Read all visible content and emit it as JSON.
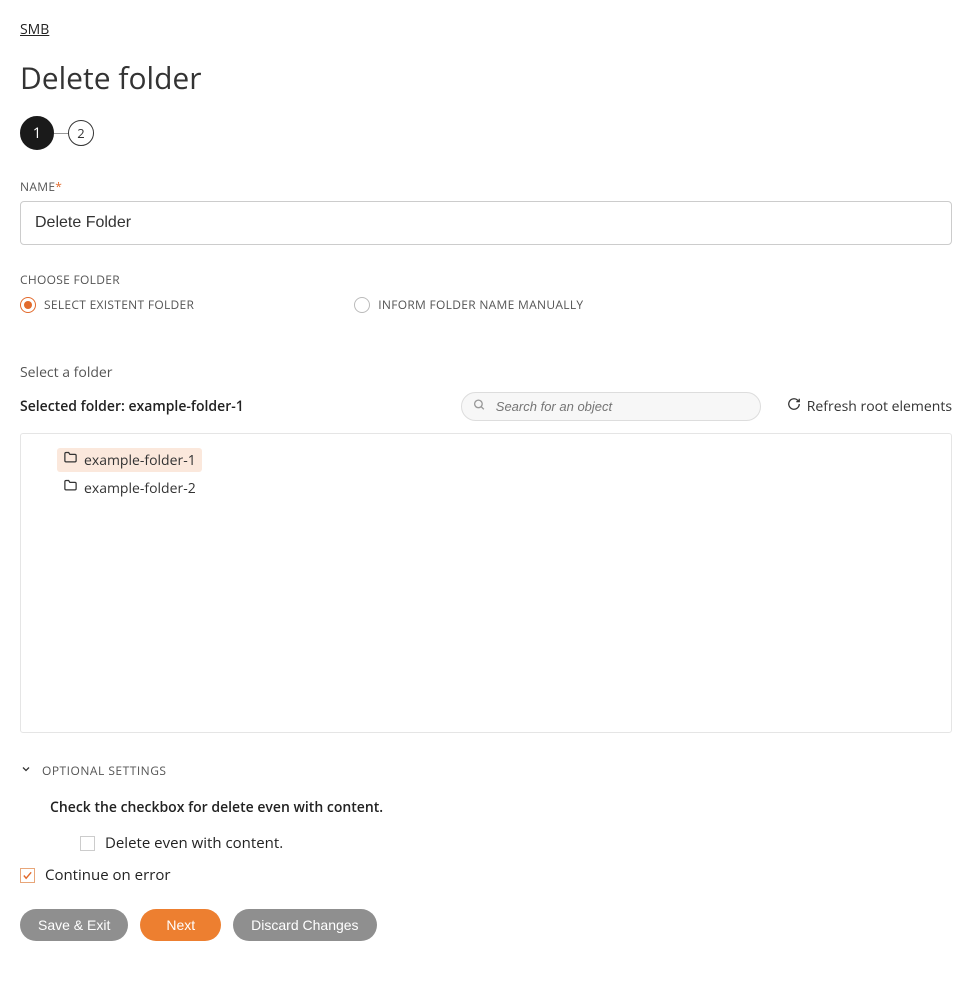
{
  "breadcrumb": "SMB",
  "page_title": "Delete folder",
  "stepper": {
    "steps": [
      "1",
      "2"
    ],
    "active_index": 0
  },
  "name_field": {
    "label": "NAME",
    "value": "Delete Folder"
  },
  "choose_folder": {
    "label": "CHOOSE FOLDER",
    "options": [
      {
        "label": "SELECT EXISTENT FOLDER",
        "selected": true
      },
      {
        "label": "INFORM FOLDER NAME MANUALLY",
        "selected": false
      }
    ]
  },
  "select_folder_heading": "Select a folder",
  "selected_folder": {
    "prefix": "Selected folder: ",
    "value": "example-folder-1"
  },
  "search": {
    "placeholder": "Search for an object"
  },
  "refresh_label": "Refresh root elements",
  "tree": [
    {
      "label": "example-folder-1",
      "selected": true
    },
    {
      "label": "example-folder-2",
      "selected": false
    }
  ],
  "optional": {
    "header": "OPTIONAL SETTINGS",
    "instruction": "Check the checkbox for delete even with content.",
    "delete_with_content": {
      "label": "Delete even with content.",
      "checked": false
    },
    "continue_on_error": {
      "label": "Continue on error",
      "checked": true
    }
  },
  "buttons": {
    "save_exit": "Save & Exit",
    "next": "Next",
    "discard": "Discard Changes"
  }
}
